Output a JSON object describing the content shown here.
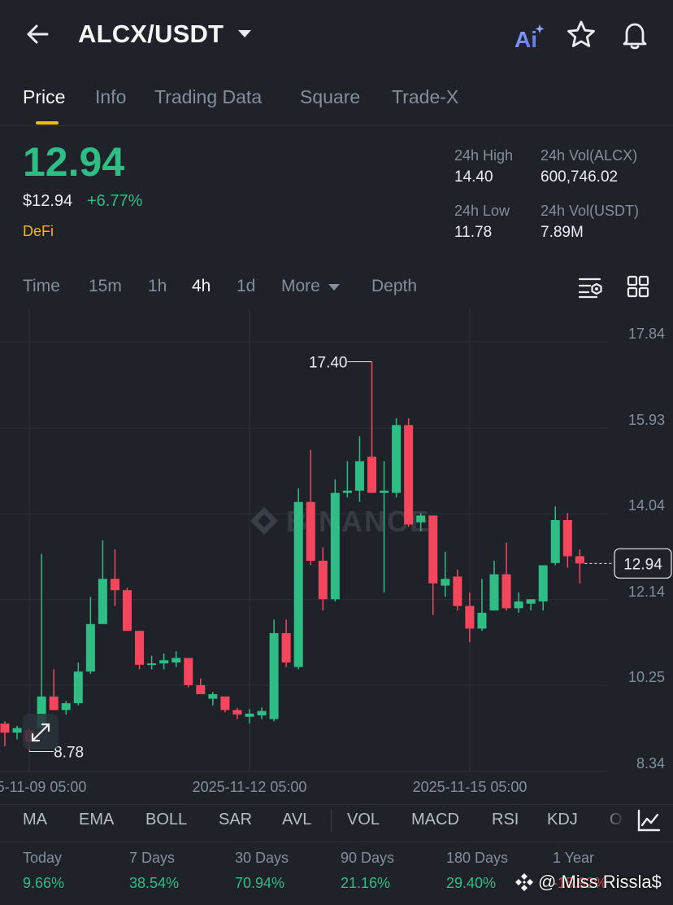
{
  "header": {
    "pair": "ALCX/USDT",
    "ai_label": "Ai"
  },
  "tabs": [
    {
      "label": "Price",
      "active": true
    },
    {
      "label": "Info"
    },
    {
      "label": "Trading Data"
    },
    {
      "label": "Square"
    },
    {
      "label": "Trade-X"
    }
  ],
  "price": {
    "last": "12.94",
    "usd": "$12.94",
    "change_pct": "+6.77%",
    "tag": "DeFi"
  },
  "stats": {
    "high_label": "24h High",
    "high_value": "14.40",
    "low_label": "24h Low",
    "low_value": "11.78",
    "vol_alcx_label": "24h Vol(ALCX)",
    "vol_alcx_value": "600,746.02",
    "vol_usdt_label": "24h Vol(USDT)",
    "vol_usdt_value": "7.89M"
  },
  "intervals": [
    {
      "label": "Time"
    },
    {
      "label": "15m"
    },
    {
      "label": "1h"
    },
    {
      "label": "4h",
      "active": true
    },
    {
      "label": "1d"
    },
    {
      "label": "More"
    },
    {
      "label": "Depth"
    }
  ],
  "chart_data": {
    "type": "candlestick",
    "y_ticks": [
      "17.84",
      "15.93",
      "14.04",
      "12.14",
      "10.25",
      "8.34"
    ],
    "x_tick_labels": [
      "2025-11-09 05:00",
      "2025-11-12 05:00",
      "2025-11-15 05:00"
    ],
    "ylim": [
      8.34,
      17.84
    ],
    "annotations": {
      "high": "17.40",
      "low": "8.78",
      "current": "12.94"
    },
    "watermark": "BINANCE",
    "colors": {
      "up": "#2ebd85",
      "down": "#f6465d"
    },
    "candles": [
      {
        "o": 9.4,
        "h": 9.45,
        "l": 8.9,
        "c": 9.2
      },
      {
        "o": 9.2,
        "h": 9.35,
        "l": 9.05,
        "c": 9.3
      },
      {
        "o": 9.25,
        "h": 9.3,
        "l": 8.78,
        "c": 9.0
      },
      {
        "o": 9.3,
        "h": 13.15,
        "l": 9.2,
        "c": 10.0
      },
      {
        "o": 10.0,
        "h": 10.6,
        "l": 9.7,
        "c": 9.7
      },
      {
        "o": 9.7,
        "h": 9.9,
        "l": 9.6,
        "c": 9.85
      },
      {
        "o": 9.85,
        "h": 10.75,
        "l": 9.8,
        "c": 10.55
      },
      {
        "o": 10.55,
        "h": 12.2,
        "l": 10.5,
        "c": 11.6
      },
      {
        "o": 11.6,
        "h": 13.45,
        "l": 11.6,
        "c": 12.6
      },
      {
        "o": 12.6,
        "h": 13.25,
        "l": 12.0,
        "c": 12.35
      },
      {
        "o": 12.35,
        "h": 12.4,
        "l": 11.45,
        "c": 11.45
      },
      {
        "o": 11.45,
        "h": 11.45,
        "l": 10.6,
        "c": 10.7
      },
      {
        "o": 10.7,
        "h": 10.9,
        "l": 10.6,
        "c": 10.73
      },
      {
        "o": 10.73,
        "h": 10.95,
        "l": 10.6,
        "c": 10.8
      },
      {
        "o": 10.75,
        "h": 11.0,
        "l": 10.65,
        "c": 10.85
      },
      {
        "o": 10.85,
        "h": 10.85,
        "l": 10.2,
        "c": 10.25
      },
      {
        "o": 10.25,
        "h": 10.4,
        "l": 10.05,
        "c": 10.05
      },
      {
        "o": 9.95,
        "h": 10.1,
        "l": 9.8,
        "c": 10.05
      },
      {
        "o": 10.0,
        "h": 10.0,
        "l": 9.65,
        "c": 9.7
      },
      {
        "o": 9.7,
        "h": 9.75,
        "l": 9.5,
        "c": 9.6
      },
      {
        "o": 9.55,
        "h": 9.72,
        "l": 9.4,
        "c": 9.62
      },
      {
        "o": 9.58,
        "h": 9.76,
        "l": 9.5,
        "c": 9.68
      },
      {
        "o": 9.5,
        "h": 11.7,
        "l": 9.45,
        "c": 11.4
      },
      {
        "o": 11.4,
        "h": 11.7,
        "l": 10.65,
        "c": 10.75
      },
      {
        "o": 10.65,
        "h": 14.6,
        "l": 10.6,
        "c": 14.3
      },
      {
        "o": 14.3,
        "h": 15.45,
        "l": 12.9,
        "c": 13.0
      },
      {
        "o": 13.0,
        "h": 13.3,
        "l": 11.9,
        "c": 12.15
      },
      {
        "o": 12.15,
        "h": 14.8,
        "l": 12.1,
        "c": 14.5
      },
      {
        "o": 14.5,
        "h": 15.2,
        "l": 14.4,
        "c": 14.55
      },
      {
        "o": 14.55,
        "h": 15.75,
        "l": 14.3,
        "c": 15.2
      },
      {
        "o": 15.3,
        "h": 17.4,
        "l": 14.5,
        "c": 14.5
      },
      {
        "o": 14.5,
        "h": 15.2,
        "l": 12.3,
        "c": 14.55
      },
      {
        "o": 14.5,
        "h": 16.15,
        "l": 14.4,
        "c": 16.0
      },
      {
        "o": 16.0,
        "h": 16.15,
        "l": 13.75,
        "c": 13.8
      },
      {
        "o": 13.85,
        "h": 14.05,
        "l": 13.65,
        "c": 14.0
      },
      {
        "o": 14.0,
        "h": 14.0,
        "l": 11.8,
        "c": 12.5
      },
      {
        "o": 12.45,
        "h": 13.2,
        "l": 12.2,
        "c": 12.6
      },
      {
        "o": 12.65,
        "h": 12.8,
        "l": 11.9,
        "c": 12.0
      },
      {
        "o": 12.0,
        "h": 12.3,
        "l": 11.2,
        "c": 11.5
      },
      {
        "o": 11.5,
        "h": 12.6,
        "l": 11.45,
        "c": 11.85
      },
      {
        "o": 11.9,
        "h": 13.0,
        "l": 11.9,
        "c": 12.7
      },
      {
        "o": 12.7,
        "h": 13.4,
        "l": 11.9,
        "c": 11.95
      },
      {
        "o": 11.95,
        "h": 12.3,
        "l": 11.85,
        "c": 12.1
      },
      {
        "o": 12.05,
        "h": 12.15,
        "l": 11.9,
        "c": 12.15
      },
      {
        "o": 12.1,
        "h": 12.85,
        "l": 11.9,
        "c": 12.9
      },
      {
        "o": 12.95,
        "h": 14.2,
        "l": 12.9,
        "c": 13.9
      },
      {
        "o": 13.9,
        "h": 14.05,
        "l": 12.85,
        "c": 13.1
      },
      {
        "o": 13.1,
        "h": 13.25,
        "l": 12.5,
        "c": 12.94
      }
    ]
  },
  "indicators": [
    "MA",
    "EMA",
    "BOLL",
    "SAR",
    "AVL",
    "VOL",
    "MACD",
    "RSI",
    "KDJ",
    "O"
  ],
  "performance": [
    {
      "label": "Today",
      "value": "9.66%",
      "color": "#2ebd85"
    },
    {
      "label": "7 Days",
      "value": "38.54%",
      "color": "#2ebd85"
    },
    {
      "label": "30 Days",
      "value": "70.94%",
      "color": "#2ebd85"
    },
    {
      "label": "90 Days",
      "value": "21.16%",
      "color": "#2ebd85"
    },
    {
      "label": "180 Days",
      "value": "29.40%",
      "color": "#2ebd85"
    },
    {
      "label": "1 Year",
      "value": "-15.92%",
      "color": "#f6465d"
    }
  ],
  "watermark_bottom": "@ Miss Rissla$"
}
